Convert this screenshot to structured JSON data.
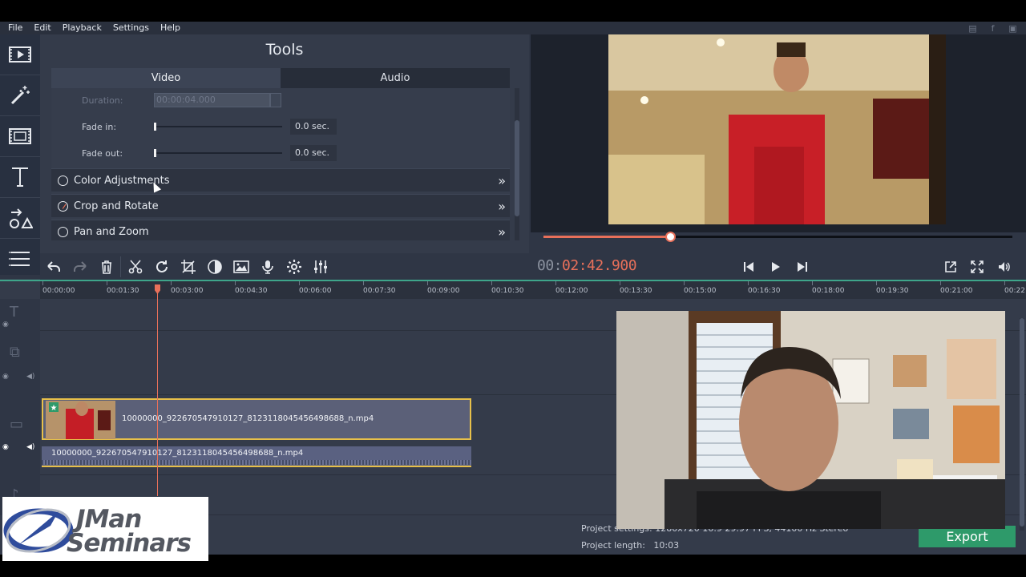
{
  "menu": [
    "File",
    "Edit",
    "Playback",
    "Settings",
    "Help"
  ],
  "social_icons": [
    "youtube-icon",
    "facebook-icon",
    "vk-icon"
  ],
  "left_tools": [
    "import-media-icon",
    "magic-wand-icon",
    "transitions-icon",
    "titles-icon",
    "stickers-icon",
    "more-tools-icon"
  ],
  "tools": {
    "title": "Tools",
    "tabs": [
      {
        "label": "Video",
        "active": true
      },
      {
        "label": "Audio",
        "active": false
      }
    ],
    "duration_label": "Duration:",
    "duration_value": "00:00:04.000",
    "fade_in_label": "Fade in:",
    "fade_in_value": "0.0 sec.",
    "fade_out_label": "Fade out:",
    "fade_out_value": "0.0 sec.",
    "sections": [
      {
        "label": "Color Adjustments",
        "checked": false
      },
      {
        "label": "Crop and Rotate",
        "checked": true
      },
      {
        "label": "Pan and Zoom",
        "checked": false
      }
    ]
  },
  "player": {
    "timecode_prefix": "00:",
    "timecode_main": "02:42.900",
    "progress_fraction": 0.27
  },
  "toolbar_buttons": [
    "undo-icon",
    "redo-icon",
    "delete-icon",
    "cut-icon",
    "rotate-icon",
    "crop-icon",
    "color-adjust-icon",
    "image-icon",
    "microphone-icon",
    "settings-icon",
    "equalizer-icon"
  ],
  "ruler_ticks": [
    "00:00:00",
    "00:01:30",
    "00:03:00",
    "00:04:30",
    "00:06:00",
    "00:07:30",
    "00:09:00",
    "00:10:30",
    "00:12:00",
    "00:13:30",
    "00:15:00",
    "00:16:30",
    "00:18:00",
    "00:19:30",
    "00:21:00",
    "00:22"
  ],
  "timeline": {
    "video_clip_name": "10000000_922670547910127_8123118045456498688_n.mp4",
    "audio_clip_name": "10000000_922670547910127_8123118045456498688_n.mp4"
  },
  "project": {
    "settings_label": "Project settings:",
    "settings_value": "1280x720 16:9 29.97 FPS, 44100 Hz Stereo",
    "length_label": "Project length:",
    "length_value": "10:03"
  },
  "export_label": "Export",
  "logo": {
    "line1": "JMan",
    "line2": "Seminars"
  },
  "colors": {
    "accent": "#e8705a",
    "export": "#2e9a6a",
    "clip_border": "#e7c04a"
  }
}
